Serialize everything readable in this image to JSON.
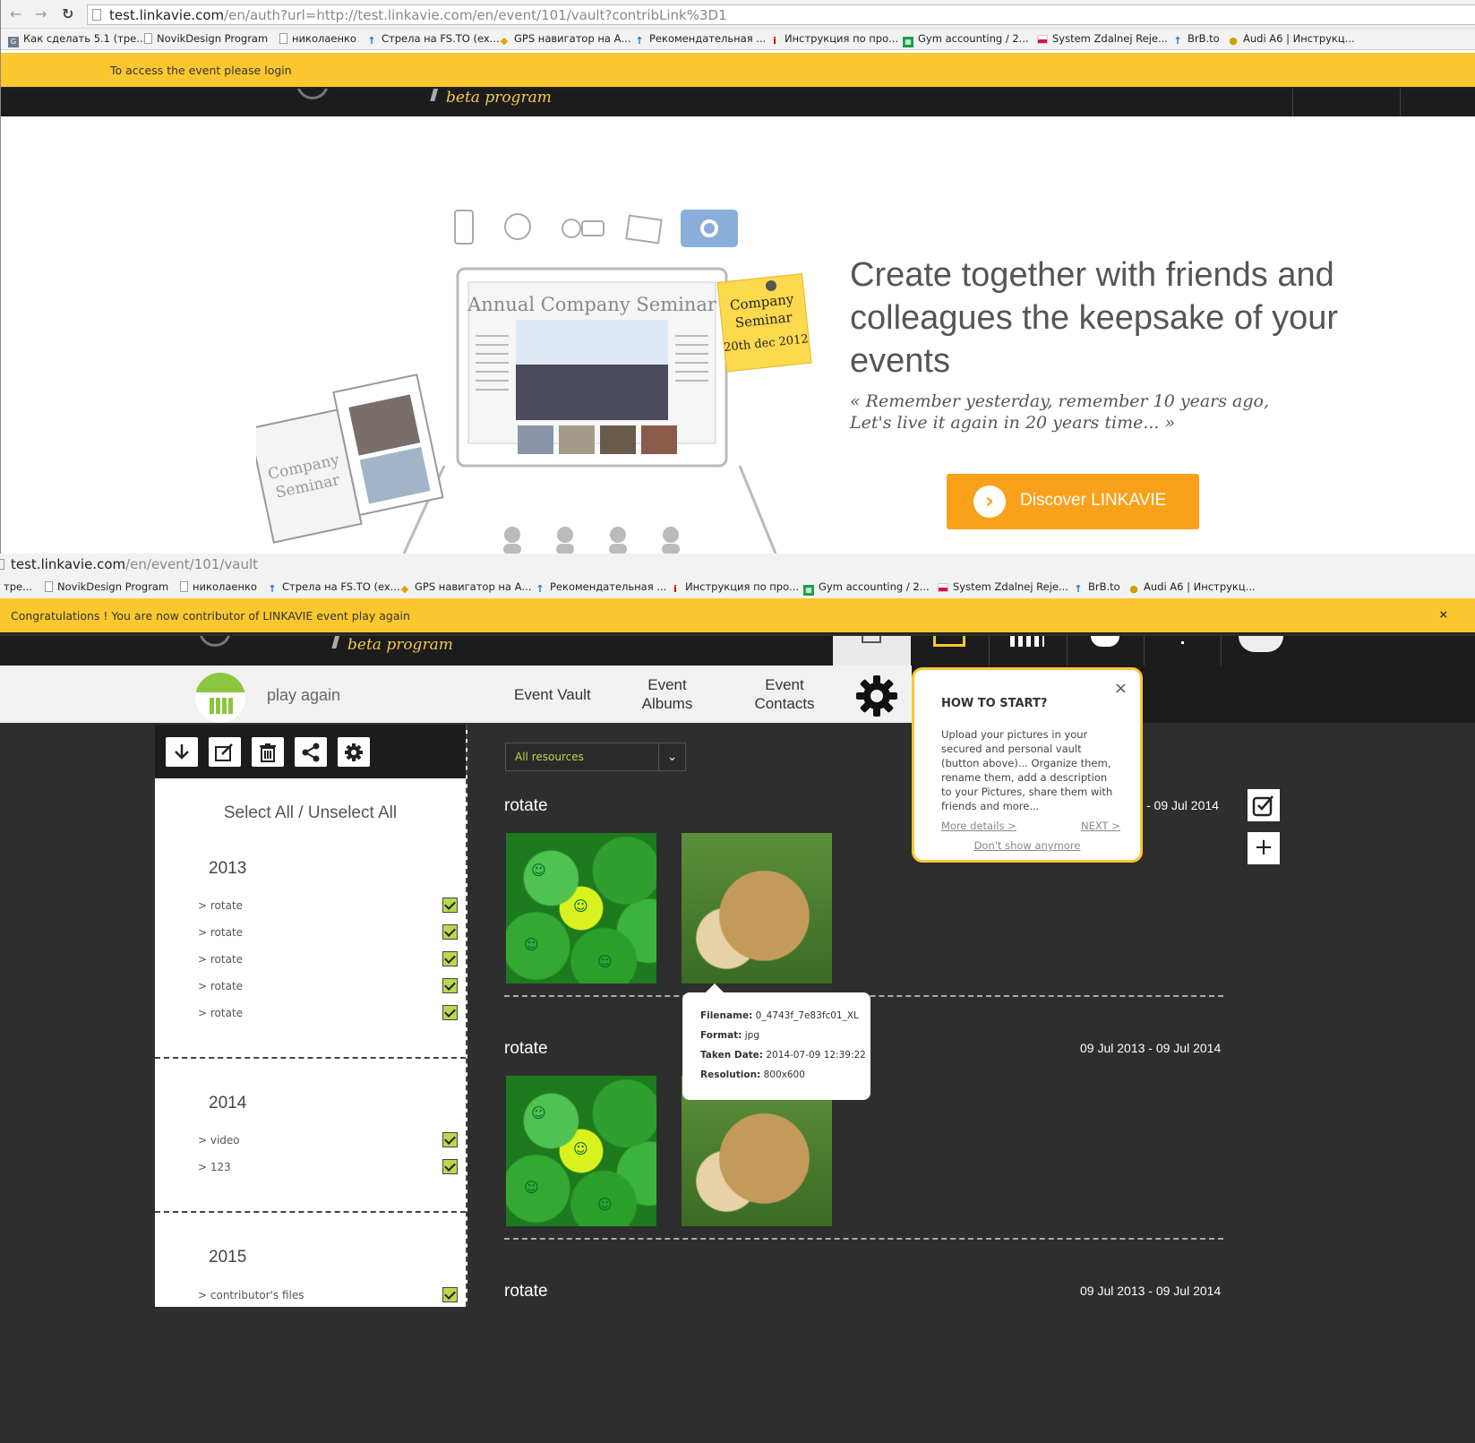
{
  "top_window": {
    "url_main": "test.linkavie.com",
    "url_rest": "/en/auth?url=http://test.linkavie.com/en/event/101/vault?contribLink%3D1",
    "bookmarks": [
      "Как сделать 5.1 (тре...",
      "NovikDesign Program",
      "николаенко",
      "Стрела на FS.TO (ex...",
      "GPS навигатор на А...",
      "Рекомендательная ...",
      "Инструкция по про...",
      "Gym accounting / 2...",
      "System Zdalnej Reje...",
      "BrB.to",
      "Audi A6 | Инструкц..."
    ],
    "notice": "To access the event please login",
    "beta_label": "beta program",
    "illustration": {
      "screen_title": "Annual Company Seminar",
      "note_line1": "Company",
      "note_line2": "Seminar",
      "note_line3": "20th dec 2012",
      "book_line1": "Company",
      "book_line2": "Seminar"
    },
    "hero_title": "Create together with friends and colleagues the keepsake of your events",
    "hero_quote_line1": "« Remember yesterday, remember 10 years ago,",
    "hero_quote_line2": "Let's live it again in 20 years time... »",
    "discover_label": "Discover LINKAVIE"
  },
  "bottom_window": {
    "url_main": "test.linkavie.com",
    "url_rest": "/en/event/101/vault",
    "bookmarks": [
      "тре...",
      "NovikDesign Program",
      "николаенко",
      "Стрела на FS.TO (ex...",
      "GPS навигатор на А...",
      "Рекомендательная ...",
      "Инструкция по про...",
      "Gym accounting / 2...",
      "System Zdalnej Reje...",
      "BrB.to",
      "Audi A6 | Инструкц..."
    ],
    "notice": "Congratulations ! You are now contributor of LINKAVIE event play again",
    "notice_close": "×",
    "beta_label": "beta program",
    "event_name": "play again",
    "tabs": {
      "vault": "Event Vault",
      "albums_l1": "Event",
      "albums_l2": "Albums",
      "contacts_l1": "Event",
      "contacts_l2": "Contacts"
    },
    "sidebar": {
      "select_all": "Select All / Unselect All",
      "years": [
        {
          "year": "2013",
          "folders": [
            "rotate",
            "rotate",
            "rotate",
            "rotate",
            "rotate"
          ]
        },
        {
          "year": "2014",
          "folders": [
            "video",
            "123"
          ]
        },
        {
          "year": "2015",
          "folders": [
            "contributor's files"
          ]
        }
      ]
    },
    "filter": {
      "selected": "All resources"
    },
    "albums": [
      {
        "title": "rotate",
        "date": "- 09 Jul 2014"
      },
      {
        "title": "rotate",
        "date": "09 Jul 2013 - 09 Jul 2014"
      },
      {
        "title": "rotate",
        "date": "09 Jul 2013 - 09 Jul 2014"
      }
    ],
    "tooltip": {
      "filename_label": "Filename:",
      "filename": "0_4743f_7e83fc01_XL",
      "format_label": "Format:",
      "format": "jpg",
      "taken_label": "Taken Date:",
      "taken": "2014-07-09 12:39:22",
      "resolution_label": "Resolution:",
      "resolution": "800x600"
    },
    "howto": {
      "title": "HOW TO START?",
      "body": "Upload your pictures in your secured and personal vault (button above)... Organize them, rename them, add a description to your Pictures, share them with friends and more...",
      "more": "More details >",
      "next": "NEXT >",
      "dont_show": "Don't show anymore",
      "close": "×"
    }
  },
  "colors": {
    "accent_yellow": "#fbc72e",
    "accent_orange": "#f9a11b",
    "accent_green": "#b9d84f",
    "dark": "#1c1c1c"
  }
}
